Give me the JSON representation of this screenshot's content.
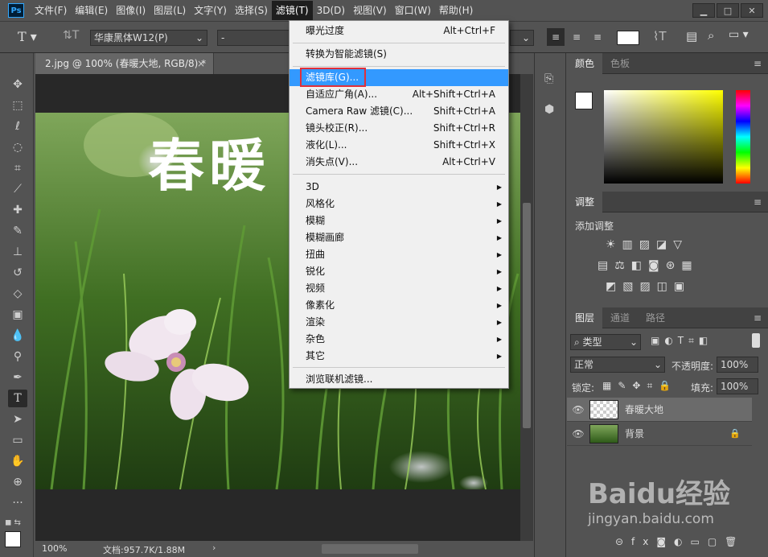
{
  "menubar": {
    "items": [
      "文件(F)",
      "编辑(E)",
      "图像(I)",
      "图层(L)",
      "文字(Y)",
      "选择(S)",
      "滤镜(T)",
      "3D(D)",
      "视图(V)",
      "窗口(W)",
      "帮助(H)"
    ],
    "active": "滤镜(T)"
  },
  "options": {
    "font_family": "华康黑体W12(P)",
    "font_style": "-"
  },
  "document": {
    "tab_title": "2.jpg @ 100% (春暖大地, RGB/8) *",
    "overlay_text": "春暖",
    "status_zoom": "100%",
    "status_doc": "文档:957.7K/1.88M"
  },
  "filter_menu": {
    "items": [
      {
        "label": "曝光过度",
        "shortcut": "Alt+Ctrl+F"
      },
      {
        "label": "转换为智能滤镜(S)",
        "shortcut": ""
      },
      {
        "label": "滤镜库(G)...",
        "shortcut": ""
      },
      {
        "label": "自适应广角(A)...",
        "shortcut": "Alt+Shift+Ctrl+A"
      },
      {
        "label": "Camera Raw 滤镜(C)...",
        "shortcut": "Shift+Ctrl+A"
      },
      {
        "label": "镜头校正(R)...",
        "shortcut": "Shift+Ctrl+R"
      },
      {
        "label": "液化(L)...",
        "shortcut": "Shift+Ctrl+X"
      },
      {
        "label": "消失点(V)...",
        "shortcut": "Alt+Ctrl+V"
      },
      {
        "label": "3D",
        "shortcut": ""
      },
      {
        "label": "风格化",
        "shortcut": ""
      },
      {
        "label": "模糊",
        "shortcut": ""
      },
      {
        "label": "模糊画廊",
        "shortcut": ""
      },
      {
        "label": "扭曲",
        "shortcut": ""
      },
      {
        "label": "锐化",
        "shortcut": ""
      },
      {
        "label": "视频",
        "shortcut": ""
      },
      {
        "label": "像素化",
        "shortcut": ""
      },
      {
        "label": "渲染",
        "shortcut": ""
      },
      {
        "label": "杂色",
        "shortcut": ""
      },
      {
        "label": "其它",
        "shortcut": ""
      },
      {
        "label": "浏览联机滤镜...",
        "shortcut": ""
      }
    ],
    "highlighted": "滤镜库(G)..."
  },
  "color_panel": {
    "tabs": [
      "颜色",
      "色板"
    ]
  },
  "adjust_panel": {
    "tab": "调整",
    "add_label": "添加调整"
  },
  "layers_panel": {
    "tabs": [
      "图层",
      "通道",
      "路径"
    ],
    "filter_kind": "类型",
    "blend_mode": "正常",
    "opacity_label": "不透明度:",
    "opacity": "100%",
    "lock_label": "锁定:",
    "fill_label": "填充:",
    "fill": "100%",
    "layers": [
      {
        "name": "春暖大地",
        "type": "text",
        "selected": true
      },
      {
        "name": "背景",
        "type": "image",
        "locked": true
      }
    ]
  },
  "watermark": {
    "brand": "Baidu经验",
    "url": "jingyan.baidu.com"
  }
}
